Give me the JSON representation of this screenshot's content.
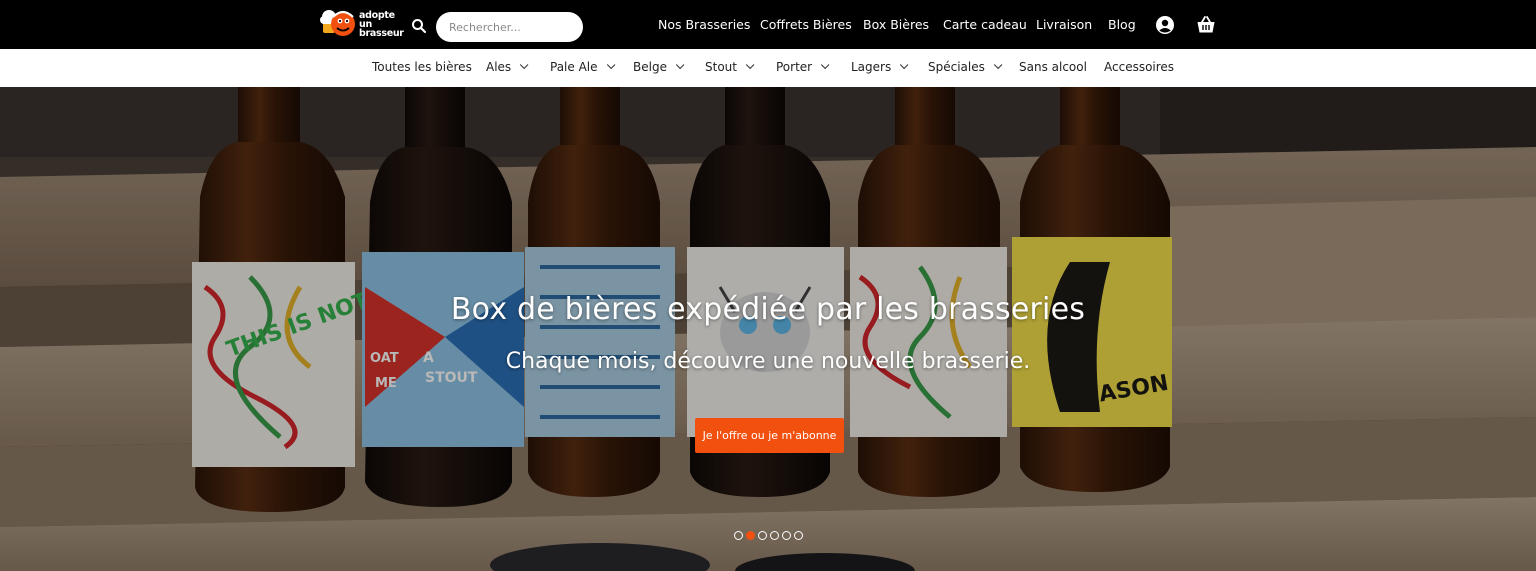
{
  "brand": {
    "line1": "adopte",
    "line2": "un",
    "line3": "brasseur"
  },
  "search": {
    "placeholder": "Rechercher..."
  },
  "top_nav": [
    {
      "label": "Nos Brasseries"
    },
    {
      "label": "Coffrets Bières"
    },
    {
      "label": "Box Bières"
    },
    {
      "label": "Carte cadeau"
    },
    {
      "label": "Livraison"
    },
    {
      "label": "Blog"
    }
  ],
  "categories": [
    {
      "label": "Toutes les bières",
      "dropdown": false
    },
    {
      "label": "Ales",
      "dropdown": true
    },
    {
      "label": "Pale Ale",
      "dropdown": true
    },
    {
      "label": "Belge",
      "dropdown": true
    },
    {
      "label": "Stout",
      "dropdown": true
    },
    {
      "label": "Porter",
      "dropdown": true
    },
    {
      "label": "Lagers",
      "dropdown": true
    },
    {
      "label": "Spéciales",
      "dropdown": true
    },
    {
      "label": "Sans alcool",
      "dropdown": false
    },
    {
      "label": "Accessoires",
      "dropdown": false
    }
  ],
  "hero": {
    "title": "Box de bières expédiée par les brasseries",
    "subtitle": "Chaque mois, découvre une nouvelle brasserie.",
    "cta_label": "Je l'offre ou je m'abonne",
    "slides_total": 6,
    "active_slide": 2,
    "label_texts": {
      "l1": "THIS IS NOT A PILS",
      "l2a": "A",
      "l2b": "STOUT",
      "l2c": "OAT",
      "l2d": "ME",
      "l6": "SEASON"
    }
  },
  "icons": {
    "search": "search-icon",
    "account": "user-icon",
    "cart": "basket-icon"
  },
  "colors": {
    "accent": "#f2500f",
    "topbar": "#000000",
    "catbar": "#ffffff"
  }
}
